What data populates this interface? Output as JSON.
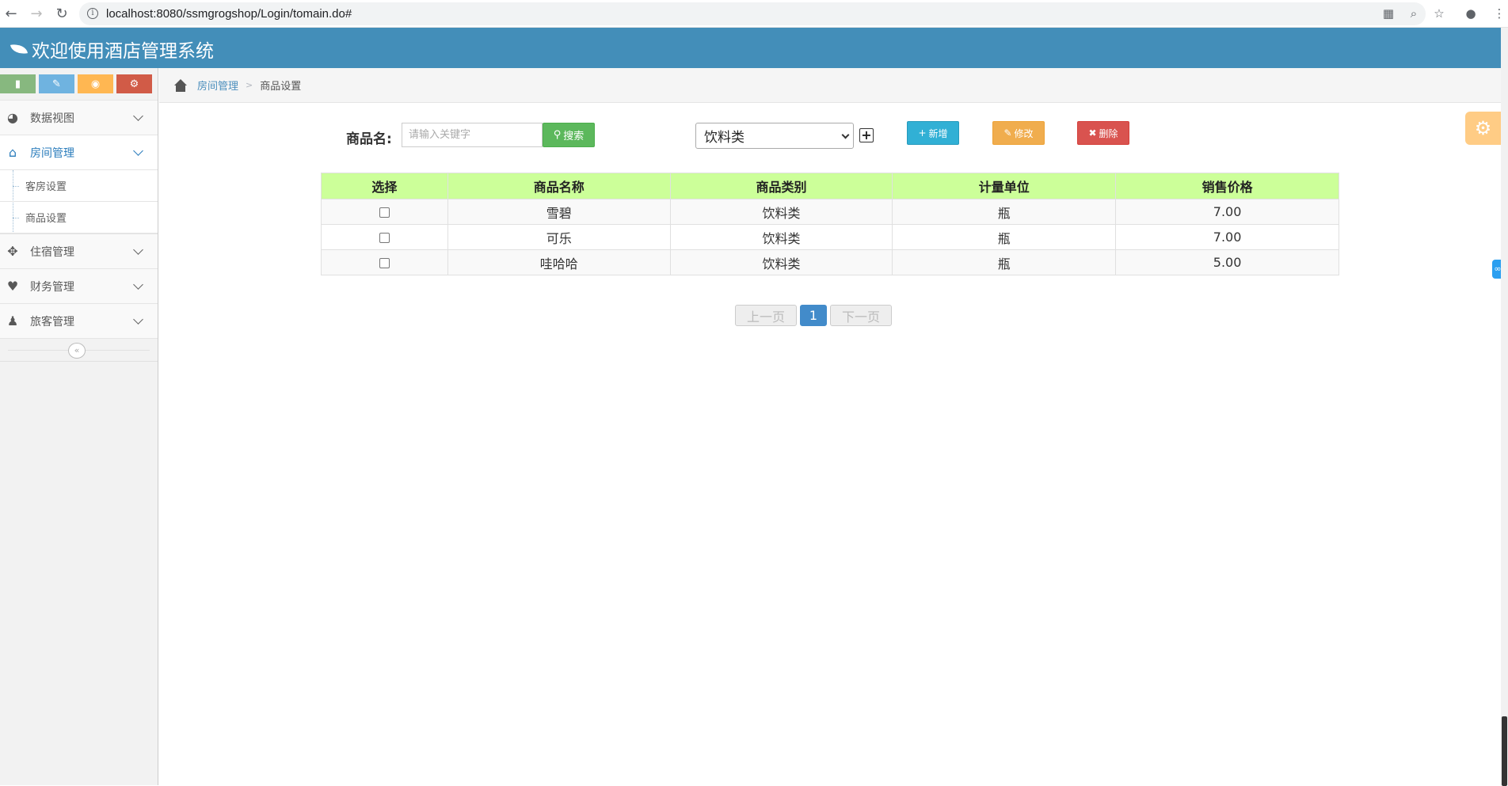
{
  "browser": {
    "url": "localhost:8080/ssmgrogshop/Login/tomain.do#"
  },
  "app": {
    "title": "欢迎使用酒店管理系统"
  },
  "sidebar": {
    "menu": [
      {
        "label": "数据视图",
        "icon": "dashboard-icon"
      },
      {
        "label": "房间管理",
        "icon": "home-icon",
        "active": true,
        "children": [
          {
            "label": "客房设置"
          },
          {
            "label": "商品设置"
          }
        ]
      },
      {
        "label": "住宿管理",
        "icon": "move-icon"
      },
      {
        "label": "财务管理",
        "icon": "heart-icon"
      },
      {
        "label": "旅客管理",
        "icon": "user-icon"
      }
    ],
    "collapse_glyph": "«"
  },
  "breadcrumb": {
    "parent": "房间管理",
    "current": "商品设置"
  },
  "toolbar": {
    "name_label": "商品名:",
    "search_placeholder": "请输入关键字",
    "search_label": "搜索",
    "category_selected": "饮料类",
    "add_glyph": "+",
    "new_label": "新增",
    "edit_label": "修改",
    "delete_label": "删除"
  },
  "table": {
    "headers": [
      "选择",
      "商品名称",
      "商品类别",
      "计量单位",
      "销售价格"
    ],
    "rows": [
      {
        "name": "雪碧",
        "category": "饮料类",
        "unit": "瓶",
        "price": "7.00"
      },
      {
        "name": "可乐",
        "category": "饮料类",
        "unit": "瓶",
        "price": "7.00"
      },
      {
        "name": "哇哈哈",
        "category": "饮料类",
        "unit": "瓶",
        "price": "5.00"
      }
    ]
  },
  "pagination": {
    "prev_label": "上一页",
    "current_page": "1",
    "next_label": "下一页"
  },
  "colors": {
    "header_bg": "#438eb9",
    "table_header_bg": "#ccff99",
    "search_btn": "#5cb85c",
    "new_btn": "#31b0d5",
    "edit_btn": "#f0ad4e",
    "delete_btn": "#d9534f",
    "page_active": "#428bca"
  }
}
